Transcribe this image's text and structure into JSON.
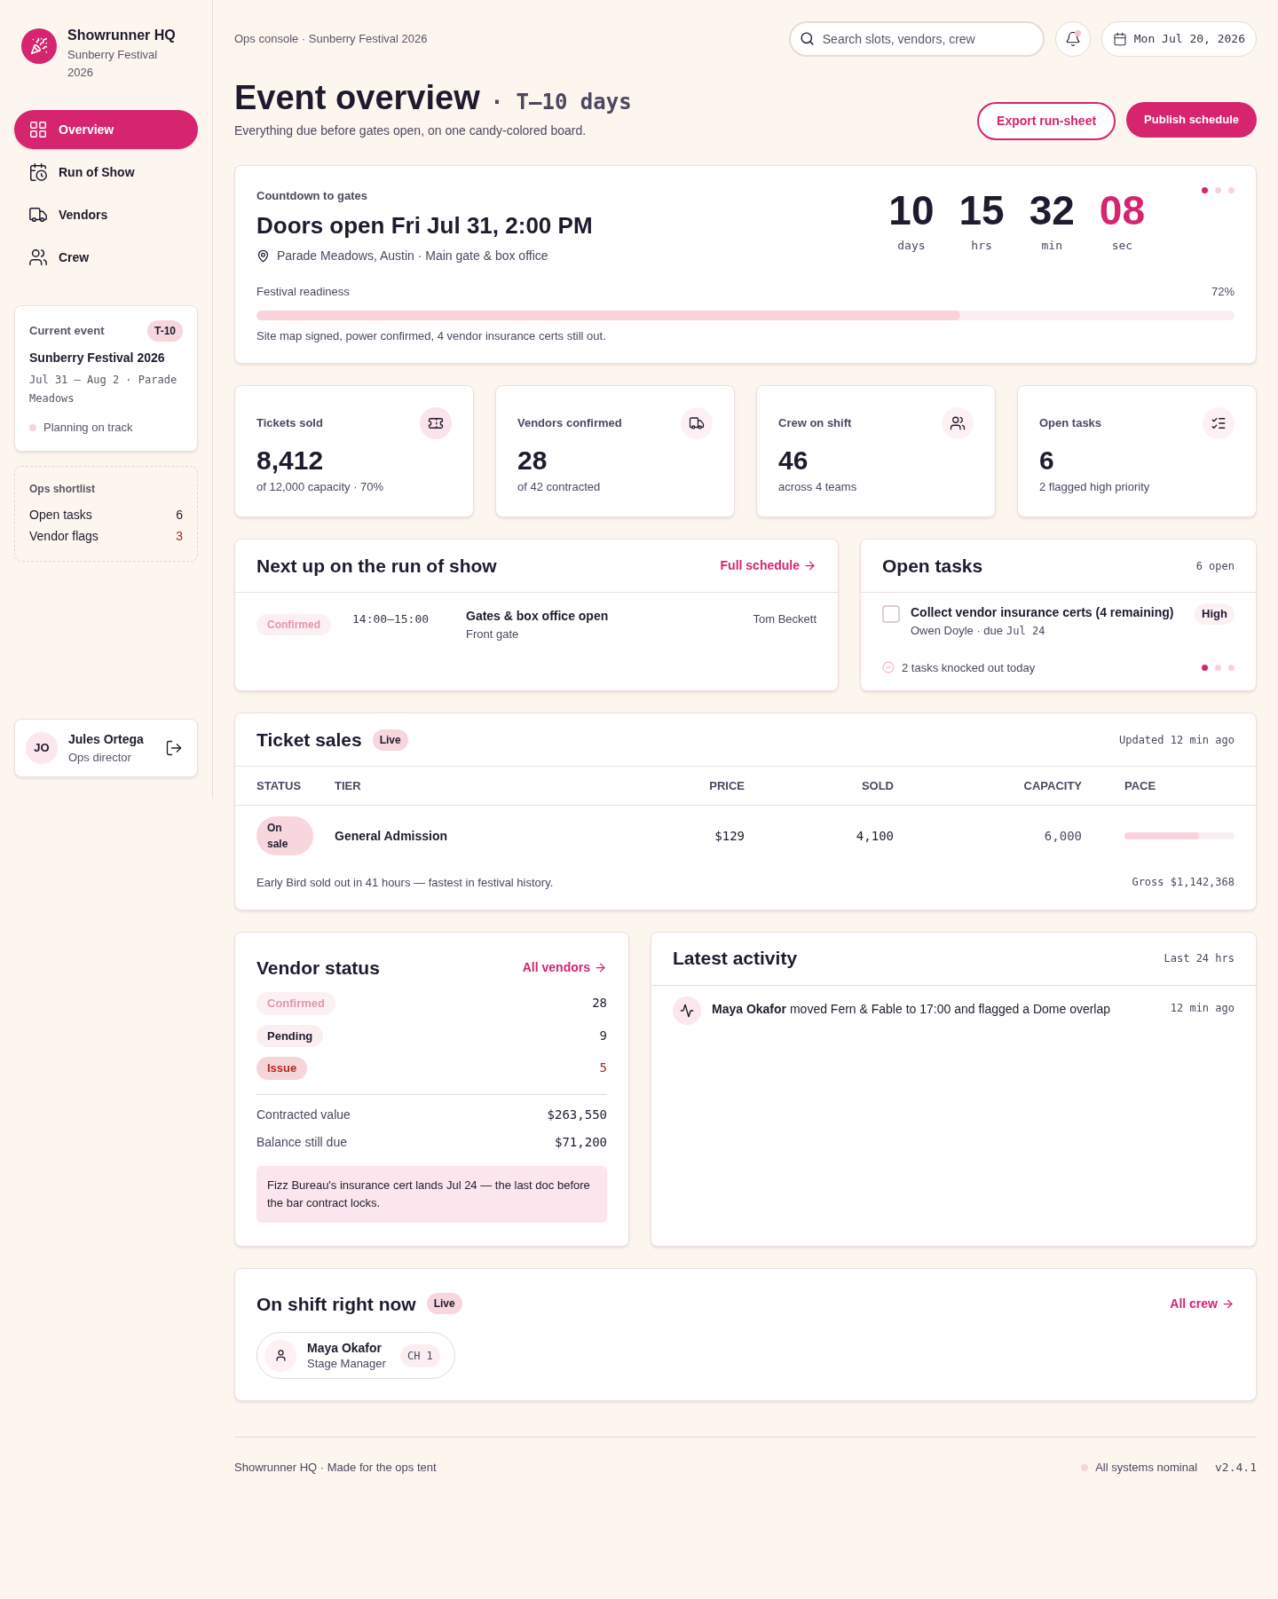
{
  "brand": {
    "name": "Showrunner HQ",
    "subtitle": "Sunberry Festival 2026"
  },
  "nav": [
    {
      "label": "Overview",
      "selected": true
    },
    {
      "label": "Run of Show",
      "selected": false
    },
    {
      "label": "Vendors",
      "selected": false
    },
    {
      "label": "Crew",
      "selected": false
    }
  ],
  "current_event": {
    "heading": "Current event",
    "badge": "T-10",
    "name": "Sunberry Festival 2026",
    "dates": "Jul 31 — Aug 2 · Parade Meadows",
    "status": "Planning on track"
  },
  "shortlist": {
    "title": "Ops shortlist",
    "items": [
      {
        "label": "Open tasks",
        "value": "6",
        "alert": false
      },
      {
        "label": "Vendor flags",
        "value": "3",
        "alert": true
      }
    ]
  },
  "user": {
    "initials": "JO",
    "name": "Jules Ortega",
    "role": "Ops director"
  },
  "breadcrumb": "Ops console · Sunberry Festival 2026",
  "search": {
    "placeholder": "Search slots, vendors, crew"
  },
  "notifications": {
    "unread": true
  },
  "date": "Mon Jul 20, 2026",
  "page": {
    "title": "Event overview",
    "tag": "· T–10 days",
    "subtitle": "Everything due before gates open, on one candy-colored board."
  },
  "actions": [
    {
      "label": "Export run-sheet",
      "kind": "outline"
    },
    {
      "label": "Publish schedule",
      "kind": "primary"
    }
  ],
  "countdown": {
    "label": "Countdown to gates",
    "title": "Doors open Fri Jul 31, 2:00 PM",
    "location": "Parade Meadows, Austin · Main gate & box office",
    "units": [
      {
        "value": "10",
        "unit": "days",
        "highlight": false
      },
      {
        "value": "15",
        "unit": "hrs",
        "highlight": false
      },
      {
        "value": "32",
        "unit": "min",
        "highlight": false
      },
      {
        "value": "08",
        "unit": "sec",
        "highlight": true
      }
    ],
    "dots": [
      {
        "selected": true
      },
      {
        "selected": false
      },
      {
        "selected": false
      }
    ],
    "readiness": {
      "label": "Festival readiness",
      "reading": "72%",
      "level": 0.72,
      "note": "Site map signed, power confirmed, 4 vendor insurance certs still out."
    }
  },
  "stats": [
    {
      "label": "Tickets sold",
      "value": "8,412",
      "note": "of 12,000 capacity · 70%"
    },
    {
      "label": "Vendors confirmed",
      "value": "28",
      "note": "of 42 contracted"
    },
    {
      "label": "Crew on shift",
      "value": "46",
      "note": "across 4 teams"
    },
    {
      "label": "Open tasks",
      "value": "6",
      "note": "2 flagged high priority"
    }
  ],
  "run_of_show": {
    "title": "Next up on the run of show",
    "link": "Full schedule",
    "items": [
      {
        "status": "Confirmed",
        "kind": "confirmed",
        "time": "14:00–15:00",
        "name": "Gates & box office open",
        "place": "Front gate",
        "owner": "Tom Beckett"
      }
    ]
  },
  "open_tasks": {
    "title": "Open tasks",
    "count": "6 open",
    "items": [
      {
        "title": "Collect vendor insurance certs (4 remaining)",
        "owner": "Owen Doyle · due",
        "due": "Jul 24",
        "priority": "High",
        "checked": false
      }
    ],
    "summary": "2 tasks knocked out today",
    "dots": [
      {
        "selected": true
      },
      {
        "selected": false
      },
      {
        "selected": false
      }
    ]
  },
  "ticket_sales": {
    "title": "Ticket sales",
    "badge": "Live",
    "updated": "Updated 12 min ago",
    "columns": [
      "STATUS",
      "TIER",
      "PRICE",
      "SOLD",
      "CAPACITY",
      "PACE"
    ],
    "rows": [
      {
        "status": "On sale",
        "tier": "General Admission",
        "price": "$129",
        "sold": "4,100",
        "capacity": "6,000",
        "level": 0.68
      }
    ],
    "note": "Early Bird sold out in 41 hours — fastest in festival history.",
    "gross": "Gross $1,142,368"
  },
  "vendor_status": {
    "title": "Vendor status",
    "link": "All vendors",
    "items": [
      {
        "label": "Confirmed",
        "kind": "confirmed",
        "count": "28"
      },
      {
        "label": "Pending",
        "kind": "pending",
        "count": "9"
      },
      {
        "label": "Issue",
        "kind": "issue",
        "count": "5"
      }
    ],
    "totals": [
      {
        "label": "Contracted value",
        "value": "$263,550"
      },
      {
        "label": "Balance still due",
        "value": "$71,200"
      }
    ],
    "note": "Fizz Bureau's insurance cert lands Jul 24 — the last doc before the bar contract locks."
  },
  "activity": {
    "title": "Latest activity",
    "range": "Last 24 hrs",
    "items": [
      {
        "text": "**Maya Okafor** moved Fern & Fable to 17:00 and flagged a Dome overlap",
        "time": "12 min ago"
      }
    ]
  },
  "on_shift": {
    "title": "On shift right now",
    "badge": "Live",
    "link": "All crew",
    "people": [
      {
        "name": "Maya Okafor",
        "role": "Stage Manager",
        "channel": "CH 1"
      }
    ]
  },
  "footer": {
    "text": "Showrunner HQ · Made for the ops tent",
    "status": "All systems nominal",
    "version": "v2.4.1"
  }
}
